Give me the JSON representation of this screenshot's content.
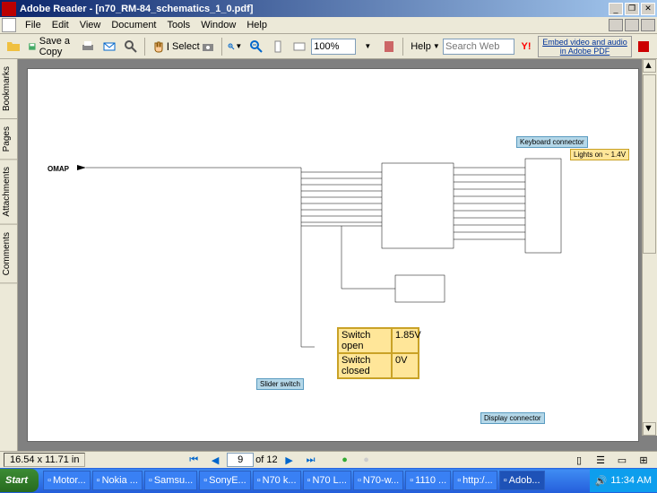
{
  "titlebar": {
    "text": "Adobe Reader - [n70_RM-84_schematics_1_0.pdf]"
  },
  "menu": {
    "file": "File",
    "edit": "Edit",
    "view": "View",
    "document": "Document",
    "tools": "Tools",
    "window": "Window",
    "help": "Help"
  },
  "toolbar": {
    "save_copy": "Save a Copy",
    "select": "Select",
    "zoom_value": "100%",
    "help": "Help",
    "search_placeholder": "Search Web",
    "embed_text": "Embed video and audio in Adobe PDF"
  },
  "side_tabs": [
    "Bookmarks",
    "Pages",
    "Attachments",
    "Comments"
  ],
  "schematic": {
    "omap_label": "OMAP",
    "kb_conn": "Keyboard connector",
    "lights": "Lights on ~ 1.4V",
    "switch_open_label": "Switch open",
    "switch_open_val": "1.85V",
    "switch_closed_label": "Switch closed",
    "switch_closed_val": "0V",
    "slider_switch": "Slider switch",
    "display_conn": "Display connector"
  },
  "statusbar": {
    "dims": "16.54 x 11.71 in",
    "page_current": "9",
    "page_total": "of 12"
  },
  "taskbar": {
    "start": "Start",
    "items": [
      "Motor...",
      "Nokia ...",
      "Samsu...",
      "SonyE...",
      "N70 k...",
      "N70 L...",
      "N70-w...",
      "1110 ...",
      "http:/...",
      "Adob..."
    ],
    "time": "11:34 AM"
  }
}
